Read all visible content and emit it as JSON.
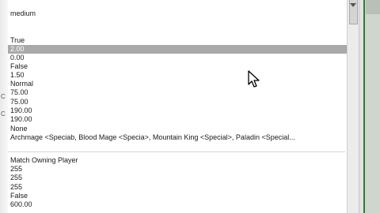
{
  "properties": {
    "values": [
      "medium",
      "",
      "",
      "True",
      "2.00",
      "0.00",
      "False",
      "1.50",
      "Normal",
      "75.00",
      "75.00",
      "190.00",
      "190.00",
      "None",
      "Archmage <Speciab, Blood Mage <Specia>, Mountain King <Special>, Paladin <Special...",
      "",
      "",
      "Match Owning Player",
      "255",
      "255",
      "255",
      "False",
      "600.00"
    ],
    "selected_index": 4
  },
  "left_edge_marks": [
    "C",
    "C"
  ]
}
